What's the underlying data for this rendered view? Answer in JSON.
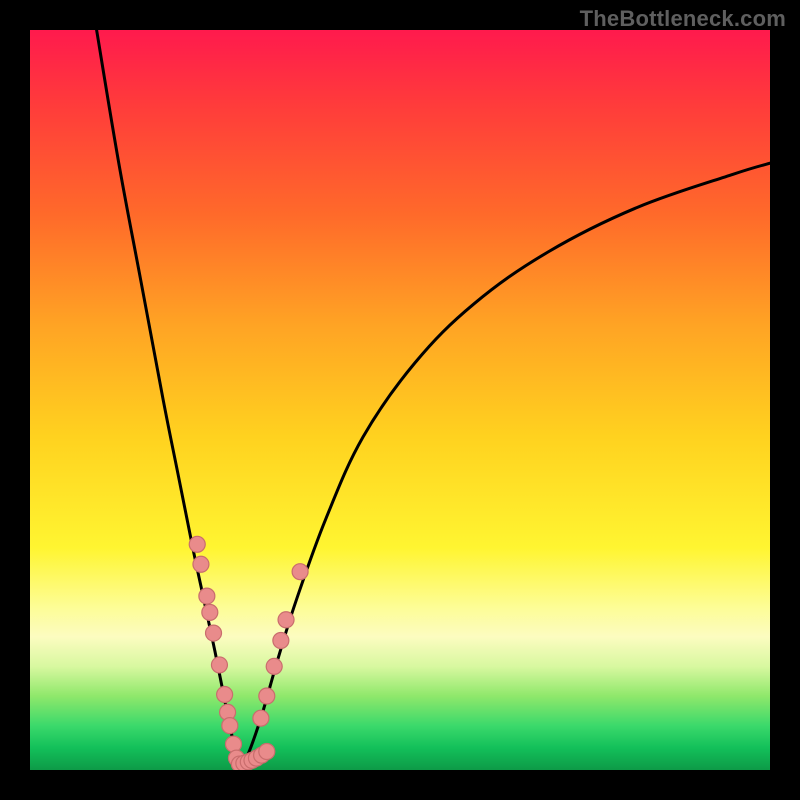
{
  "watermark": "TheBottleneck.com",
  "chart_data": {
    "type": "line",
    "title": "",
    "xlabel": "",
    "ylabel": "",
    "xlim": [
      0,
      100
    ],
    "ylim": [
      0,
      100
    ],
    "grid": false,
    "series": [
      {
        "name": "left-branch",
        "x": [
          9,
          12,
          15,
          18,
          20,
          22,
          23.5,
          25,
          26.2,
          27.1,
          27.8,
          28.3
        ],
        "y": [
          100,
          82,
          66,
          50,
          40,
          30,
          23,
          16,
          10,
          5.5,
          2.5,
          0.8
        ]
      },
      {
        "name": "right-branch",
        "x": [
          28.3,
          29,
          30,
          31.5,
          33.5,
          36,
          40,
          45,
          52,
          60,
          70,
          82,
          95,
          100
        ],
        "y": [
          0.8,
          1.2,
          3.5,
          8,
          15,
          23,
          34,
          45,
          55,
          63,
          70,
          76,
          80.5,
          82
        ]
      }
    ],
    "markers": {
      "name": "data-points",
      "color": "#e98b8b",
      "points": [
        {
          "x": 22.6,
          "y": 30.5
        },
        {
          "x": 23.1,
          "y": 27.8
        },
        {
          "x": 23.9,
          "y": 23.5
        },
        {
          "x": 24.3,
          "y": 21.3
        },
        {
          "x": 24.8,
          "y": 18.5
        },
        {
          "x": 25.6,
          "y": 14.2
        },
        {
          "x": 26.3,
          "y": 10.2
        },
        {
          "x": 26.7,
          "y": 7.8
        },
        {
          "x": 27.0,
          "y": 6.0
        },
        {
          "x": 27.5,
          "y": 3.5
        },
        {
          "x": 27.9,
          "y": 1.6
        },
        {
          "x": 28.3,
          "y": 0.8
        },
        {
          "x": 28.9,
          "y": 0.9
        },
        {
          "x": 29.5,
          "y": 1.1
        },
        {
          "x": 30.0,
          "y": 1.3
        },
        {
          "x": 30.6,
          "y": 1.6
        },
        {
          "x": 31.3,
          "y": 2.0
        },
        {
          "x": 32.0,
          "y": 2.5
        },
        {
          "x": 31.2,
          "y": 7.0
        },
        {
          "x": 32.0,
          "y": 10.0
        },
        {
          "x": 33.0,
          "y": 14.0
        },
        {
          "x": 33.9,
          "y": 17.5
        },
        {
          "x": 34.6,
          "y": 20.3
        },
        {
          "x": 36.5,
          "y": 26.8
        }
      ]
    }
  }
}
